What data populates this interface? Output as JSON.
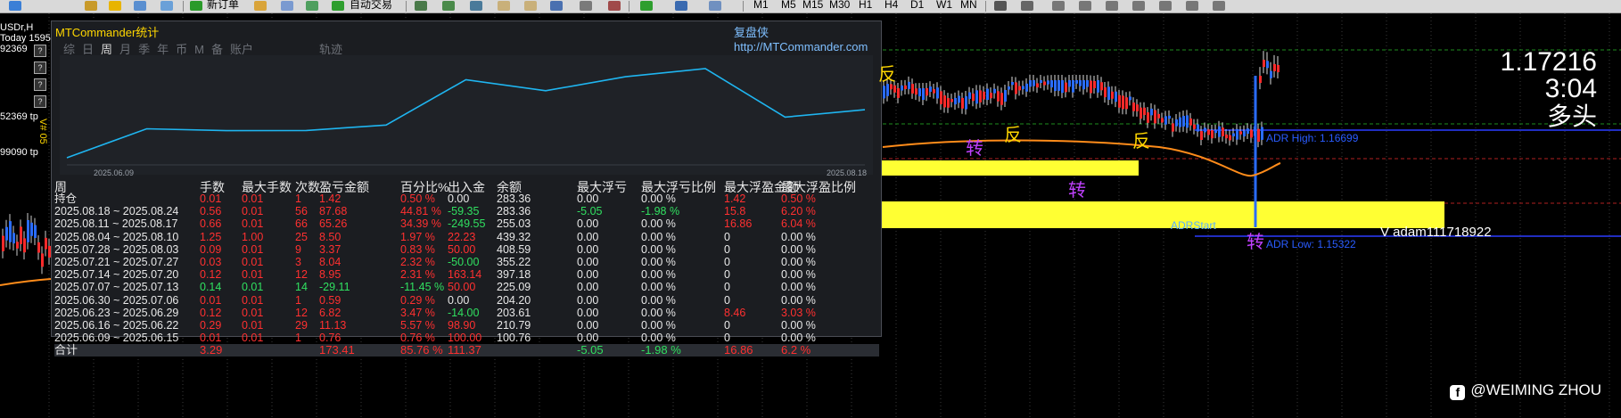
{
  "toolbar": {
    "items": [
      "新订单",
      "自动交易"
    ],
    "timeframes": [
      "M1",
      "M5",
      "M15",
      "M30",
      "H1",
      "H4",
      "D1",
      "W1",
      "MN"
    ]
  },
  "left_labels": {
    "symbol": "USDr,H",
    "today": "Today 1595",
    "num1": "92369",
    "num2": "52369 tp",
    "num3": "99090 tp",
    "vertical": "V# 05"
  },
  "panel": {
    "title": "MTCommander统计",
    "link_cn": "复盘侠",
    "link_url": "http://MTCommander.com",
    "tabs": [
      "综",
      "日",
      "周",
      "月",
      "季",
      "年",
      "币",
      "M",
      "备",
      "账户"
    ],
    "active_tab": "周",
    "curve_label": "轨迹",
    "side_icons": [
      "?",
      "?",
      "?",
      "?"
    ],
    "curve_start_date": "2025.06.09",
    "curve_end_date": "2025.08.18",
    "columns": [
      "周",
      "手数",
      "最大手数",
      "次数",
      "盈亏金额",
      "百分比%",
      "出入金",
      "余额",
      "最大浮亏",
      "最大浮亏比例",
      "最大浮盈金额",
      "最大浮盈比例"
    ],
    "rows": [
      {
        "c": [
          "持仓",
          "0.01",
          "0.01",
          "1",
          "1.42",
          "0.50 %",
          "0.00",
          "283.36",
          "0.00",
          "0.00 %",
          "1.42",
          "0.50 %"
        ],
        "k": [
          "w",
          "r",
          "r",
          "r",
          "r",
          "r",
          "w",
          "w",
          "w",
          "w",
          "r",
          "r"
        ]
      },
      {
        "c": [
          "2025.08.18 ~ 2025.08.24",
          "0.56",
          "0.01",
          "56",
          "87.68",
          "44.81 %",
          "-59.35",
          "283.36",
          "-5.05",
          "-1.98 %",
          "15.8",
          "6.20 %"
        ],
        "k": [
          "w",
          "r",
          "r",
          "r",
          "r",
          "r",
          "g",
          "w",
          "g",
          "g",
          "r",
          "r"
        ]
      },
      {
        "c": [
          "2025.08.11 ~ 2025.08.17",
          "0.66",
          "0.01",
          "66",
          "65.26",
          "34.39 %",
          "-249.55",
          "255.03",
          "0.00",
          "0.00 %",
          "16.86",
          "6.04 %"
        ],
        "k": [
          "w",
          "r",
          "r",
          "r",
          "r",
          "r",
          "g",
          "w",
          "w",
          "w",
          "r",
          "r"
        ]
      },
      {
        "c": [
          "2025.08.04 ~ 2025.08.10",
          "1.25",
          "1.00",
          "25",
          "8.50",
          "1.97 %",
          "22.23",
          "439.32",
          "0.00",
          "0.00 %",
          "0",
          "0.00 %"
        ],
        "k": [
          "w",
          "r",
          "r",
          "r",
          "r",
          "r",
          "r",
          "w",
          "w",
          "w",
          "w",
          "w"
        ]
      },
      {
        "c": [
          "2025.07.28 ~ 2025.08.03",
          "0.09",
          "0.01",
          "9",
          "3.37",
          "0.83 %",
          "50.00",
          "408.59",
          "0.00",
          "0.00 %",
          "0",
          "0.00 %"
        ],
        "k": [
          "w",
          "r",
          "r",
          "r",
          "r",
          "r",
          "r",
          "w",
          "w",
          "w",
          "w",
          "w"
        ]
      },
      {
        "c": [
          "2025.07.21 ~ 2025.07.27",
          "0.03",
          "0.01",
          "3",
          "8.04",
          "2.32 %",
          "-50.00",
          "355.22",
          "0.00",
          "0.00 %",
          "0",
          "0.00 %"
        ],
        "k": [
          "w",
          "r",
          "r",
          "r",
          "r",
          "r",
          "g",
          "w",
          "w",
          "w",
          "w",
          "w"
        ]
      },
      {
        "c": [
          "2025.07.14 ~ 2025.07.20",
          "0.12",
          "0.01",
          "12",
          "8.95",
          "2.31 %",
          "163.14",
          "397.18",
          "0.00",
          "0.00 %",
          "0",
          "0.00 %"
        ],
        "k": [
          "w",
          "r",
          "r",
          "r",
          "r",
          "r",
          "r",
          "w",
          "w",
          "w",
          "w",
          "w"
        ]
      },
      {
        "c": [
          "2025.07.07 ~ 2025.07.13",
          "0.14",
          "0.01",
          "14",
          "-29.11",
          "-11.45 %",
          "50.00",
          "225.09",
          "0.00",
          "0.00 %",
          "0",
          "0.00 %"
        ],
        "k": [
          "w",
          "g",
          "g",
          "g",
          "g",
          "g",
          "r",
          "w",
          "w",
          "w",
          "w",
          "w"
        ]
      },
      {
        "c": [
          "2025.06.30 ~ 2025.07.06",
          "0.01",
          "0.01",
          "1",
          "0.59",
          "0.29 %",
          "0.00",
          "204.20",
          "0.00",
          "0.00 %",
          "0",
          "0.00 %"
        ],
        "k": [
          "w",
          "r",
          "r",
          "r",
          "r",
          "r",
          "w",
          "w",
          "w",
          "w",
          "w",
          "w"
        ]
      },
      {
        "c": [
          "2025.06.23 ~ 2025.06.29",
          "0.12",
          "0.01",
          "12",
          "6.82",
          "3.47 %",
          "-14.00",
          "203.61",
          "0.00",
          "0.00 %",
          "8.46",
          "3.03 %"
        ],
        "k": [
          "w",
          "r",
          "r",
          "r",
          "r",
          "r",
          "g",
          "w",
          "w",
          "w",
          "r",
          "r"
        ]
      },
      {
        "c": [
          "2025.06.16 ~ 2025.06.22",
          "0.29",
          "0.01",
          "29",
          "11.13",
          "5.57 %",
          "98.90",
          "210.79",
          "0.00",
          "0.00 %",
          "0",
          "0.00 %"
        ],
        "k": [
          "w",
          "r",
          "r",
          "r",
          "r",
          "r",
          "r",
          "w",
          "w",
          "w",
          "w",
          "w"
        ]
      },
      {
        "c": [
          "2025.06.09 ~ 2025.06.15",
          "0.01",
          "0.01",
          "1",
          "0.76",
          "0.76 %",
          "100.00",
          "100.76",
          "0.00",
          "0.00 %",
          "0",
          "0.00 %"
        ],
        "k": [
          "w",
          "r",
          "r",
          "r",
          "r",
          "r",
          "r",
          "w",
          "w",
          "w",
          "w",
          "w"
        ]
      }
    ],
    "total": {
      "c": [
        "合计",
        "3.29",
        "",
        "",
        "173.41",
        "85.76 %",
        "111.37",
        "",
        "-5.05",
        "-1.98 %",
        "16.86",
        "6.2 %"
      ],
      "k": [
        "w",
        "r",
        "w",
        "w",
        "r",
        "r",
        "r",
        "w",
        "g",
        "g",
        "r",
        "r"
      ]
    }
  },
  "chart": {
    "price": "1.17216",
    "time": "3:04",
    "direction": "多头",
    "ann_fan": "反",
    "ann_zhuan": "转",
    "adr_high": "ADR High: 1.16699",
    "adr_low": "ADR Low: 1.15322",
    "adr_start": "ADRStart",
    "adam": "V adam111718922",
    "watermark": "@WEIMING ZHOU",
    "watermark_icon": "f"
  },
  "colors": {
    "gain": "#ff3030",
    "loss": "#30e060",
    "title": "#ffd700",
    "curve": "#1fb5f0"
  }
}
